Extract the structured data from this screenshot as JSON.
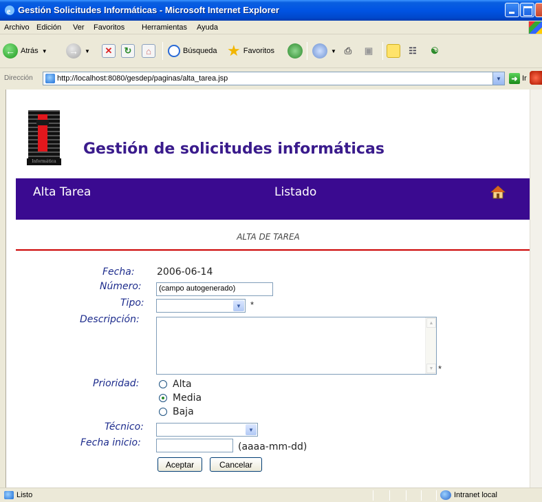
{
  "window": {
    "title": "Gestión Solicitudes Informáticas - Microsoft Internet Explorer"
  },
  "menu": [
    "Archivo",
    "Edición",
    "Ver",
    "Favoritos",
    "Herramientas",
    "Ayuda"
  ],
  "toolbar": {
    "back_label": "Atrás",
    "search_label": "Búsqueda",
    "favorites_label": "Favoritos"
  },
  "address": {
    "label": "Dirección",
    "url": "http://localhost:8080/gesdep/paginas/alta_tarea.jsp",
    "go_label": "Ir"
  },
  "page": {
    "logo_caption": "Informática",
    "app_title": "Gestión de solicitudes informáticas",
    "nav": {
      "alta_tarea": "Alta Tarea",
      "listado": "Listado"
    },
    "section_title": "ALTA DE TAREA"
  },
  "form": {
    "fecha_label": "Fecha:",
    "fecha_value": "2006-06-14",
    "numero_label": "Número:",
    "numero_value": "(campo autogenerado)",
    "tipo_label": "Tipo:",
    "tipo_value": "",
    "required_mark": "*",
    "descripcion_label": "Descripción:",
    "prioridad_label": "Prioridad:",
    "prioridad_options": [
      "Alta",
      "Media",
      "Baja"
    ],
    "prioridad_selected": "Media",
    "tecnico_label": "Técnico:",
    "tecnico_value": "",
    "fecha_inicio_label": "Fecha inicio:",
    "fecha_inicio_value": "",
    "fecha_inicio_hint": "(aaaa-mm-dd)",
    "aceptar_label": "Aceptar",
    "cancelar_label": "Cancelar"
  },
  "status": {
    "text": "Listo",
    "zone": "Intranet local"
  }
}
